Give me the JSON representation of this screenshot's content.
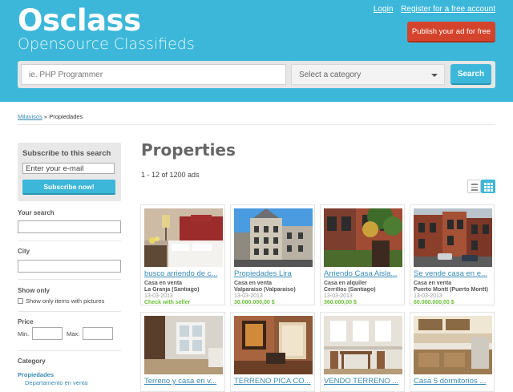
{
  "header": {
    "logo_title": "Osclass",
    "logo_subtitle": "Opensource Classifieds",
    "login_link": "Login",
    "register_link": "Register for a free account",
    "publish_button": "Publish your ad for free"
  },
  "search": {
    "placeholder": "ie. PHP Programmer",
    "category_placeholder": "Select a category",
    "button_label": "Search"
  },
  "breadcrumb": {
    "home": "Milavisos",
    "separator": " » ",
    "current": "Propiedades"
  },
  "sidebar": {
    "subscribe_title": "Subscribe to this search",
    "email_placeholder": "Enter your e-mail",
    "subscribe_button": "Subscribe now!",
    "your_search_label": "Your search",
    "city_label": "City",
    "show_only_label": "Show only",
    "pictures_checkbox_label": "Show only items with pictures",
    "price_label": "Price",
    "min_label": "Min.",
    "max_label": "Max:",
    "category_label": "Category",
    "category_current": "Propiedades",
    "category_sub": "Departamento en venta"
  },
  "main": {
    "title": "Properties",
    "results_count": "1 - 12 of 1200 ads"
  },
  "listings": [
    {
      "title": "busco arriendo de c...",
      "type": "Casa en venta",
      "location": "La Granja (Santiago)",
      "date": "13-03-2013",
      "price": "Check with seller"
    },
    {
      "title": "Propiedades Lira",
      "type": "Casa en venta",
      "location": "Valparaíso (Valparaíso)",
      "date": "13-03-2013",
      "price": "30.000.000,00 $"
    },
    {
      "title": "Arriendo Casa Aisla...",
      "type": "Casa en alquiler",
      "location": "Cerrillos (Santiago)",
      "date": "13-03-2013",
      "price": "360.000,00 $"
    },
    {
      "title": "Se vende casa en e...",
      "type": "Casa en venta",
      "location": "Puerto Montt (Puerto Montt)",
      "date": "13-03-2013",
      "price": "60.000.000,00 $"
    },
    {
      "title": "Terreno y casa en v...",
      "type": "",
      "location": "",
      "date": "",
      "price": ""
    },
    {
      "title": "TERRENO PICA CO...",
      "type": "",
      "location": "",
      "date": "",
      "price": ""
    },
    {
      "title": "VENDO TERRENO ...",
      "type": "",
      "location": "",
      "date": "",
      "price": ""
    },
    {
      "title": "Casa 5 dormitorios ...",
      "type": "",
      "location": "",
      "date": "",
      "price": ""
    }
  ],
  "colors": {
    "header_bg": "#3cb7d9",
    "publish_button": "#d4442c",
    "link": "#3a8bb5",
    "price": "#6bbf3a"
  }
}
